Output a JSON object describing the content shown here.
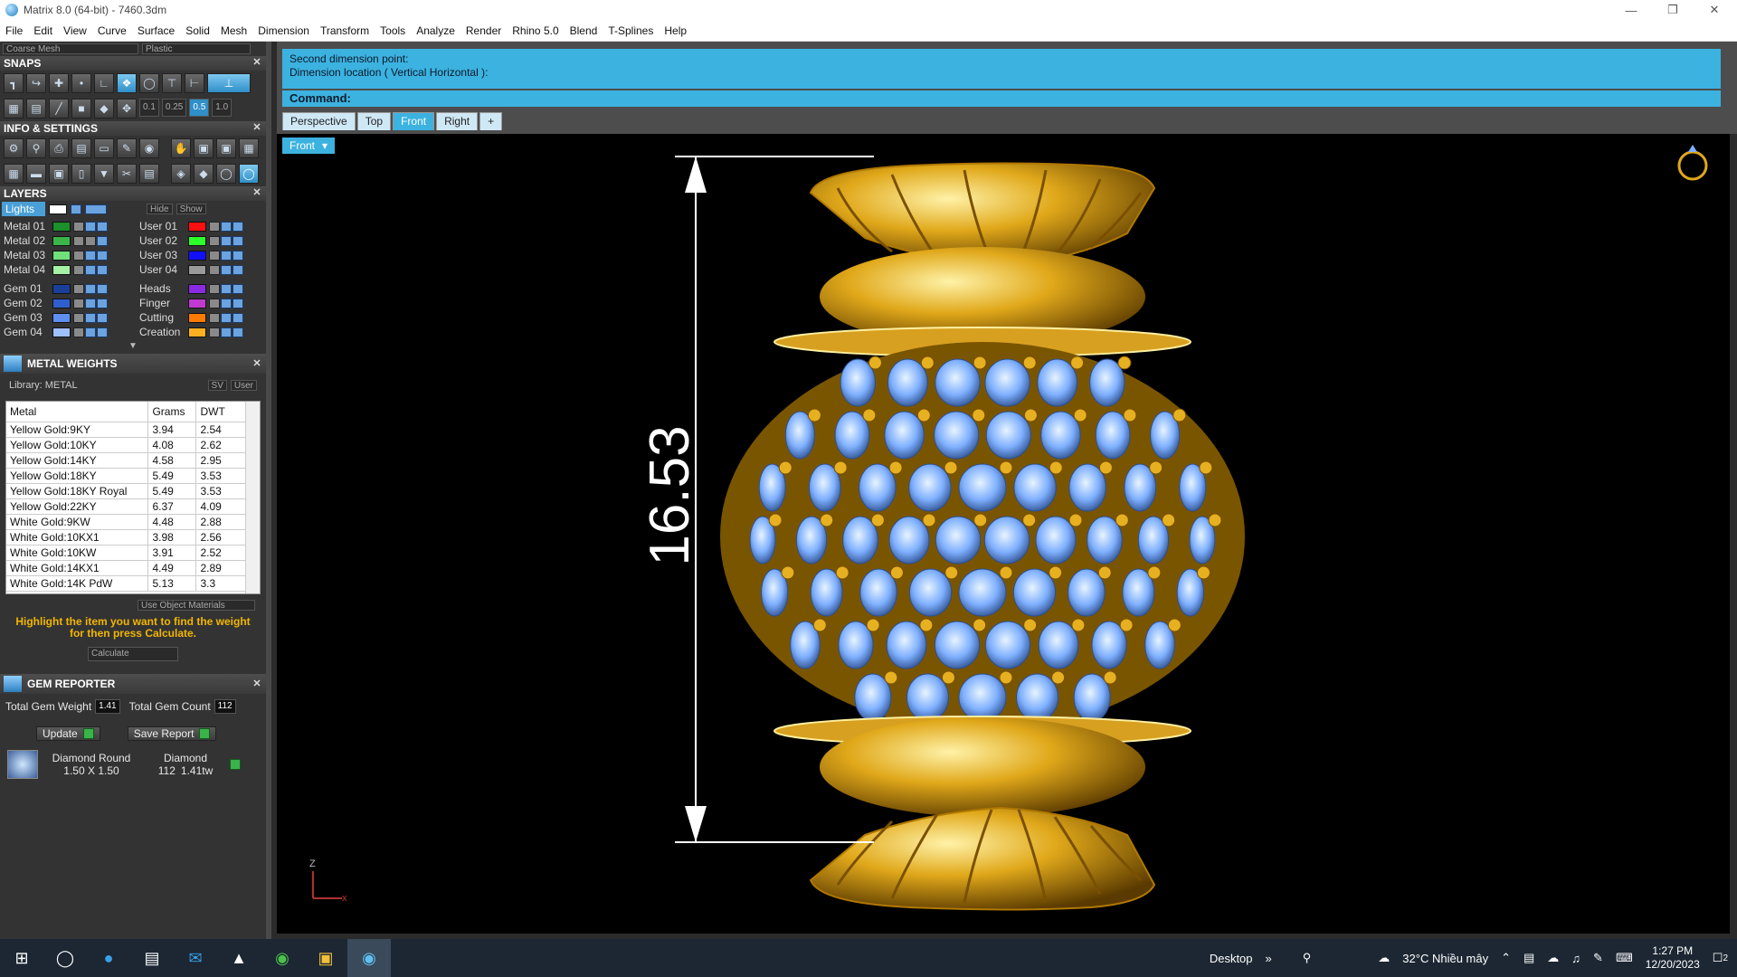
{
  "window": {
    "title": "Matrix 8.0 (64-bit) - 7460.3dm"
  },
  "menu": [
    "File",
    "Edit",
    "View",
    "Curve",
    "Surface",
    "Solid",
    "Mesh",
    "Dimension",
    "Transform",
    "Tools",
    "Analyze",
    "Render",
    "Rhino 5.0",
    "Blend",
    "T-Splines",
    "Help"
  ],
  "top_selectors": {
    "mesh": "Coarse Mesh",
    "material": "Plastic"
  },
  "panels": {
    "snaps": "SNAPS",
    "info": "INFO & SETTINGS",
    "layers": "LAYERS",
    "metal_weights": "METAL WEIGHTS",
    "gem_reporter": "GEM REPORTER"
  },
  "snap_values": [
    "0.1",
    "0.25",
    "0.5",
    "1.0"
  ],
  "layers": {
    "lights": "Lights",
    "hide": "Hide",
    "show": "Show",
    "left": [
      {
        "name": "Metal 01",
        "color": "#1a8f2a"
      },
      {
        "name": "Metal 02",
        "color": "#3bb54a"
      },
      {
        "name": "Metal 03",
        "color": "#6fe07a"
      },
      {
        "name": "Metal 04",
        "color": "#a6f0a6"
      },
      {
        "name": "Gem 01",
        "color": "#1a3f9a"
      },
      {
        "name": "Gem 02",
        "color": "#2f5fcf"
      },
      {
        "name": "Gem 03",
        "color": "#5f8ff0"
      },
      {
        "name": "Gem 04",
        "color": "#9fc0ff"
      }
    ],
    "right": [
      {
        "name": "User 01",
        "color": "#ff1010"
      },
      {
        "name": "User 02",
        "color": "#2cff2c"
      },
      {
        "name": "User 03",
        "color": "#1010ff"
      },
      {
        "name": "User 04",
        "color": "#9a9a9a"
      },
      {
        "name": "Heads",
        "color": "#8a2be2"
      },
      {
        "name": "Finger",
        "color": "#c03ad0"
      },
      {
        "name": "Cutting",
        "color": "#ff7a00"
      },
      {
        "name": "Creation",
        "color": "#ffb020"
      }
    ]
  },
  "metal_weights": {
    "library": "Library: METAL",
    "toggle_sv": "SV",
    "toggle_user": "User",
    "headers": [
      "Metal",
      "Grams",
      "DWT"
    ],
    "rows": [
      [
        "Yellow Gold:9KY",
        "3.94",
        "2.54"
      ],
      [
        "Yellow Gold:10KY",
        "4.08",
        "2.62"
      ],
      [
        "Yellow Gold:14KY",
        "4.58",
        "2.95"
      ],
      [
        "Yellow Gold:18KY",
        "5.49",
        "3.53"
      ],
      [
        "Yellow Gold:18KY Royal",
        "5.49",
        "3.53"
      ],
      [
        "Yellow Gold:22KY",
        "6.37",
        "4.09"
      ],
      [
        "White Gold:9KW",
        "4.48",
        "2.88"
      ],
      [
        "White Gold:10KX1",
        "3.98",
        "2.56"
      ],
      [
        "White Gold:10KW",
        "3.91",
        "2.52"
      ],
      [
        "White Gold:14KX1",
        "4.49",
        "2.89"
      ],
      [
        "White Gold:14K PdW",
        "5.13",
        "3.3"
      ]
    ],
    "use_object_materials": "Use Object Materials",
    "hint": "Highlight the item you want to find the weight for then press Calculate.",
    "calculate": "Calculate"
  },
  "gem_reporter": {
    "total_weight_label": "Total Gem Weight",
    "total_weight_value": "1.41",
    "total_count_label": "Total Gem Count",
    "total_count_value": "112",
    "update": "Update",
    "save_report": "Save Report",
    "gem": {
      "name": "Diamond Round",
      "size": "1.50 X 1.50",
      "type": "Diamond",
      "count": "112",
      "weight": "1.41tw"
    }
  },
  "command": {
    "line1": "Second dimension point:",
    "line2": "Dimension location ( Vertical  Horizontal ):",
    "prompt": "Command:"
  },
  "tabs": [
    "Perspective",
    "Top",
    "Front",
    "Right",
    "+"
  ],
  "viewport": {
    "label": "Front",
    "dimension": "16.53",
    "axis_z": "Z",
    "axis_x": "x"
  },
  "taskbar": {
    "desktop": "Desktop",
    "weather": "32°C  Nhiều mây",
    "time": "1:27 PM",
    "date": "12/20/2023",
    "notifications": "2"
  },
  "colors": {
    "accent": "#3cb2e0",
    "gold": "#e0a81a",
    "gem": "#7fb0ff"
  }
}
